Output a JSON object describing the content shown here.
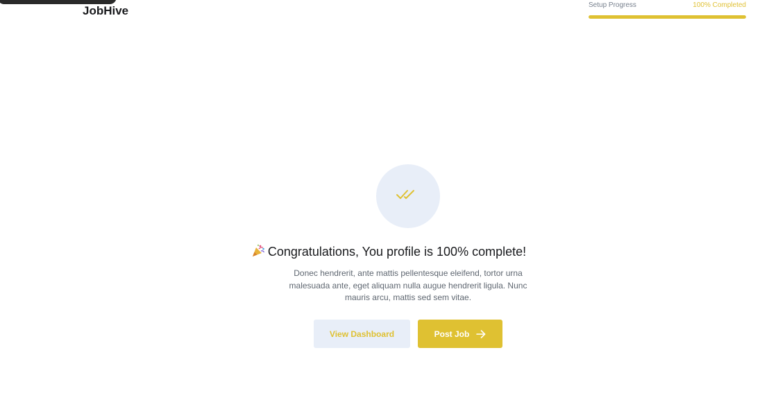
{
  "brand": {
    "name": "JobHive"
  },
  "progress": {
    "label": "Setup Progress",
    "value_text": "100% Completed",
    "percent": 100
  },
  "success": {
    "icon": "double-check-icon",
    "emoji_icon": "party-popper-icon",
    "headline": "Congratulations, You profile is 100% complete!",
    "description": "Donec hendrerit, ante mattis pellentesque eleifend, tortor urna malesuada ante, eget aliquam nulla augue hendrerit ligula. Nunc mauris arcu, mattis sed sem vitae."
  },
  "actions": {
    "view_dashboard_label": "View Dashboard",
    "post_job_label": "Post Job",
    "post_job_icon": "arrow-right-icon"
  },
  "colors": {
    "accent": "#dfc132",
    "accent_light": "#e8eef8",
    "text_dark": "#18191c",
    "text_muted": "#5e6670"
  }
}
